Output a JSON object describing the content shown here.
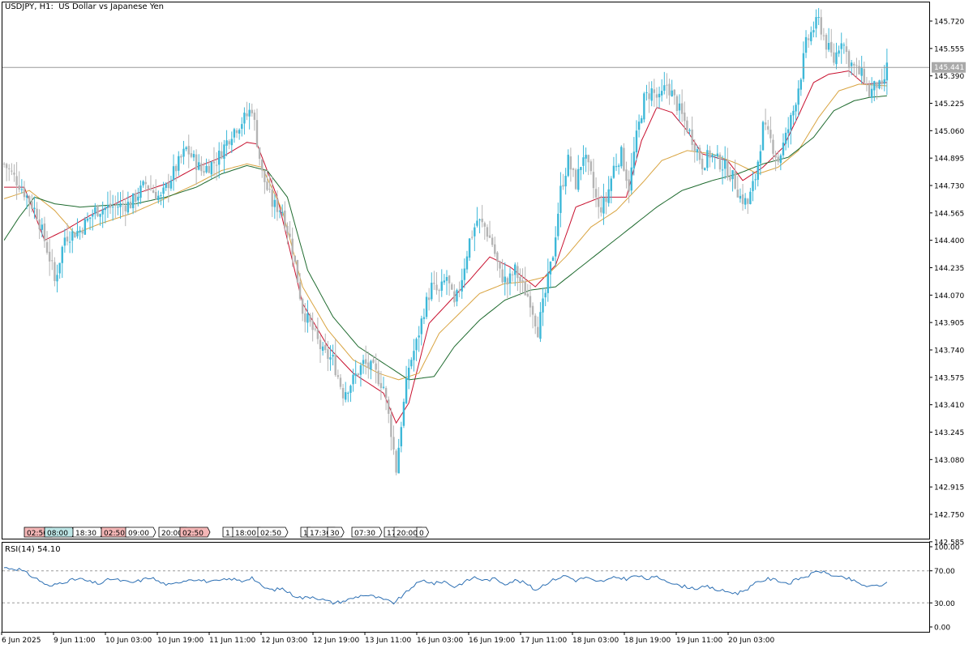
{
  "window": {
    "title": "USDJPY, H1:  US Dollar vs Japanese Yen",
    "symbol": "USDJPY",
    "timeframe": "H1",
    "description": "US Dollar vs Japanese Yen"
  },
  "colors": {
    "bull_candle": "#3db8d8",
    "bear_candle": "#b4b4b4",
    "ma_fast": "#c8102e",
    "ma_mid": "#d9a441",
    "ma_slow": "#1f6b2f",
    "rsi_line": "#2c6fb3",
    "price_line": "#9a9a9a",
    "price_label_bg": "#a9a9a9",
    "event_red": "#f4b6b6",
    "event_teal": "#bde6e6"
  },
  "price_axis": {
    "ticks": [
      "145.720",
      "145.555",
      "145.390",
      "145.225",
      "145.060",
      "144.895",
      "144.730",
      "144.565",
      "144.400",
      "144.235",
      "144.070",
      "143.905",
      "143.740",
      "143.575",
      "143.410",
      "143.245",
      "143.080",
      "142.915",
      "142.750",
      "142.585"
    ],
    "current_price_label": "145.441"
  },
  "time_axis": {
    "labels": [
      "6 Jun 2025",
      "9 Jun 11:00",
      "10 Jun 03:00",
      "10 Jun 19:00",
      "11 Jun 11:00",
      "12 Jun 03:00",
      "12 Jun 19:00",
      "13 Jun 11:00",
      "16 Jun 03:00",
      "16 Jun 19:00",
      "17 Jun 11:00",
      "18 Jun 03:00",
      "18 Jun 19:00",
      "19 Jun 11:00",
      "20 Jun 03:00"
    ]
  },
  "event_markers": [
    {
      "text": "02:50",
      "color": "red"
    },
    {
      "text": "08:00",
      "color": "teal"
    },
    {
      "text": "18:30",
      "color": "none"
    },
    {
      "text": "02:50",
      "color": "red"
    },
    {
      "text": "09:00",
      "color": "none"
    },
    {
      "text": "20:00",
      "color": "none"
    },
    {
      "text": "02:50",
      "color": "red"
    },
    {
      "text": "1",
      "color": "none"
    },
    {
      "text": "18:00",
      "color": "none"
    },
    {
      "text": "02:50",
      "color": "none"
    },
    {
      "text": "1",
      "color": "none"
    },
    {
      "text": "17:30",
      "color": "none"
    },
    {
      "text": "30",
      "color": "none"
    },
    {
      "text": "07:30",
      "color": "none"
    },
    {
      "text": "17",
      "color": "none"
    },
    {
      "text": "20:00",
      "color": "none"
    },
    {
      "text": "0",
      "color": "none"
    }
  ],
  "rsi": {
    "title": "RSI(14) 54.10",
    "ticks": [
      "100.00",
      "70.00",
      "30.00",
      "0.00"
    ],
    "levels": [
      70,
      30
    ]
  },
  "chart_data": {
    "type": "candlestick",
    "ylim": [
      142.45,
      145.8
    ],
    "current_price": 145.441,
    "xlabel": "",
    "ylabel": "",
    "candle_keypoints": [
      [
        0,
        144.86
      ],
      [
        6,
        144.74
      ],
      [
        10,
        144.64
      ],
      [
        13,
        144.56
      ],
      [
        16,
        144.4
      ],
      [
        19,
        144.24
      ],
      [
        20,
        144.15
      ],
      [
        24,
        144.42
      ],
      [
        30,
        144.46
      ],
      [
        36,
        144.58
      ],
      [
        42,
        144.6
      ],
      [
        50,
        144.62
      ],
      [
        56,
        144.74
      ],
      [
        62,
        144.65
      ],
      [
        66,
        144.78
      ],
      [
        72,
        144.95
      ],
      [
        78,
        144.82
      ],
      [
        84,
        144.88
      ],
      [
        90,
        145.05
      ],
      [
        96,
        145.15
      ],
      [
        98,
        145.2
      ],
      [
        102,
        144.8
      ],
      [
        106,
        144.62
      ],
      [
        110,
        144.58
      ],
      [
        114,
        144.35
      ],
      [
        118,
        143.98
      ],
      [
        122,
        143.86
      ],
      [
        126,
        143.72
      ],
      [
        130,
        143.68
      ],
      [
        134,
        143.48
      ],
      [
        138,
        143.56
      ],
      [
        142,
        143.66
      ],
      [
        146,
        143.62
      ],
      [
        150,
        143.52
      ],
      [
        153,
        143.25
      ],
      [
        155,
        143.02
      ],
      [
        157,
        143.3
      ],
      [
        160,
        143.64
      ],
      [
        163,
        143.78
      ],
      [
        166,
        143.98
      ],
      [
        169,
        144.12
      ],
      [
        172,
        144.08
      ],
      [
        175,
        144.18
      ],
      [
        178,
        144.0
      ],
      [
        181,
        144.18
      ],
      [
        184,
        144.4
      ],
      [
        187,
        144.52
      ],
      [
        190,
        144.48
      ],
      [
        193,
        144.38
      ],
      [
        196,
        144.2
      ],
      [
        199,
        144.14
      ],
      [
        202,
        144.22
      ],
      [
        205,
        144.12
      ],
      [
        208,
        144.04
      ],
      [
        211,
        143.86
      ],
      [
        214,
        144.08
      ],
      [
        217,
        144.32
      ],
      [
        220,
        144.7
      ],
      [
        223,
        144.88
      ],
      [
        226,
        144.74
      ],
      [
        229,
        144.92
      ],
      [
        232,
        144.78
      ],
      [
        235,
        144.58
      ],
      [
        238,
        144.64
      ],
      [
        241,
        144.84
      ],
      [
        244,
        144.92
      ],
      [
        247,
        144.72
      ],
      [
        250,
        145.02
      ],
      [
        253,
        145.25
      ],
      [
        256,
        145.3
      ],
      [
        259,
        145.24
      ],
      [
        262,
        145.34
      ],
      [
        264,
        145.28
      ],
      [
        267,
        145.18
      ],
      [
        270,
        145.08
      ],
      [
        273,
        144.98
      ],
      [
        276,
        144.86
      ],
      [
        279,
        144.92
      ],
      [
        282,
        144.88
      ],
      [
        285,
        144.84
      ],
      [
        288,
        144.78
      ],
      [
        291,
        144.66
      ],
      [
        294,
        144.62
      ],
      [
        297,
        144.78
      ],
      [
        300,
        145.08
      ],
      [
        303,
        145.0
      ],
      [
        306,
        144.88
      ],
      [
        309,
        145.02
      ],
      [
        312,
        145.18
      ],
      [
        315,
        145.4
      ],
      [
        317,
        145.58
      ],
      [
        320,
        145.68
      ],
      [
        322,
        145.72
      ],
      [
        325,
        145.58
      ],
      [
        328,
        145.48
      ],
      [
        331,
        145.62
      ],
      [
        334,
        145.48
      ],
      [
        337,
        145.42
      ],
      [
        340,
        145.38
      ],
      [
        342,
        145.28
      ],
      [
        345,
        145.34
      ],
      [
        347,
        145.3
      ],
      [
        349,
        145.44
      ]
    ],
    "series": [
      {
        "name": "",
        "values_keypoints": [
          [
            0,
            144.72
          ],
          [
            8,
            144.72
          ],
          [
            16,
            144.4
          ],
          [
            24,
            144.46
          ],
          [
            34,
            144.55
          ],
          [
            44,
            144.62
          ],
          [
            52,
            144.68
          ],
          [
            64,
            144.74
          ],
          [
            76,
            144.84
          ],
          [
            86,
            144.9
          ],
          [
            96,
            144.99
          ],
          [
            100,
            144.98
          ],
          [
            108,
            144.66
          ],
          [
            118,
            144.02
          ],
          [
            128,
            143.76
          ],
          [
            138,
            143.6
          ],
          [
            150,
            143.48
          ],
          [
            155,
            143.3
          ],
          [
            160,
            143.42
          ],
          [
            168,
            143.9
          ],
          [
            176,
            144.03
          ],
          [
            184,
            144.16
          ],
          [
            192,
            144.3
          ],
          [
            200,
            144.24
          ],
          [
            210,
            144.12
          ],
          [
            218,
            144.25
          ],
          [
            226,
            144.6
          ],
          [
            236,
            144.66
          ],
          [
            246,
            144.66
          ],
          [
            252,
            145.0
          ],
          [
            258,
            145.2
          ],
          [
            264,
            145.17
          ],
          [
            270,
            145.06
          ],
          [
            276,
            144.92
          ],
          [
            286,
            144.88
          ],
          [
            292,
            144.76
          ],
          [
            300,
            144.84
          ],
          [
            308,
            144.96
          ],
          [
            314,
            145.15
          ],
          [
            320,
            145.35
          ],
          [
            326,
            145.4
          ],
          [
            334,
            145.42
          ],
          [
            340,
            145.34
          ],
          [
            349,
            145.35
          ]
        ]
      },
      {
        "name": "",
        "values_keypoints": [
          [
            0,
            144.65
          ],
          [
            10,
            144.7
          ],
          [
            20,
            144.58
          ],
          [
            28,
            144.44
          ],
          [
            38,
            144.5
          ],
          [
            50,
            144.56
          ],
          [
            62,
            144.64
          ],
          [
            76,
            144.74
          ],
          [
            86,
            144.82
          ],
          [
            96,
            144.86
          ],
          [
            102,
            144.84
          ],
          [
            110,
            144.58
          ],
          [
            118,
            144.12
          ],
          [
            128,
            143.86
          ],
          [
            138,
            143.68
          ],
          [
            148,
            143.6
          ],
          [
            156,
            143.56
          ],
          [
            164,
            143.6
          ],
          [
            172,
            143.84
          ],
          [
            180,
            143.96
          ],
          [
            188,
            144.08
          ],
          [
            198,
            144.14
          ],
          [
            206,
            144.15
          ],
          [
            214,
            144.18
          ],
          [
            222,
            144.3
          ],
          [
            232,
            144.48
          ],
          [
            242,
            144.58
          ],
          [
            252,
            144.74
          ],
          [
            260,
            144.88
          ],
          [
            270,
            144.94
          ],
          [
            280,
            144.92
          ],
          [
            290,
            144.86
          ],
          [
            298,
            144.8
          ],
          [
            306,
            144.84
          ],
          [
            314,
            144.94
          ],
          [
            322,
            145.14
          ],
          [
            330,
            145.3
          ],
          [
            338,
            145.34
          ],
          [
            349,
            145.33
          ]
        ]
      },
      {
        "name": "",
        "values_keypoints": [
          [
            0,
            144.4
          ],
          [
            6,
            144.54
          ],
          [
            12,
            144.66
          ],
          [
            20,
            144.62
          ],
          [
            30,
            144.6
          ],
          [
            40,
            144.61
          ],
          [
            52,
            144.62
          ],
          [
            64,
            144.66
          ],
          [
            76,
            144.72
          ],
          [
            86,
            144.8
          ],
          [
            96,
            144.85
          ],
          [
            104,
            144.82
          ],
          [
            112,
            144.66
          ],
          [
            120,
            144.22
          ],
          [
            130,
            143.94
          ],
          [
            140,
            143.76
          ],
          [
            150,
            143.66
          ],
          [
            160,
            143.56
          ],
          [
            170,
            143.58
          ],
          [
            178,
            143.76
          ],
          [
            188,
            143.92
          ],
          [
            198,
            144.04
          ],
          [
            208,
            144.1
          ],
          [
            218,
            144.12
          ],
          [
            228,
            144.24
          ],
          [
            238,
            144.36
          ],
          [
            248,
            144.48
          ],
          [
            258,
            144.6
          ],
          [
            268,
            144.7
          ],
          [
            280,
            144.76
          ],
          [
            290,
            144.8
          ],
          [
            300,
            144.86
          ],
          [
            310,
            144.9
          ],
          [
            320,
            145.02
          ],
          [
            328,
            145.18
          ],
          [
            336,
            145.24
          ],
          [
            342,
            145.26
          ],
          [
            349,
            145.27
          ]
        ]
      }
    ],
    "rsi_keypoints": [
      [
        0,
        74
      ],
      [
        6,
        72
      ],
      [
        10,
        65
      ],
      [
        14,
        58
      ],
      [
        18,
        50
      ],
      [
        22,
        55
      ],
      [
        26,
        58
      ],
      [
        30,
        60
      ],
      [
        34,
        56
      ],
      [
        38,
        54
      ],
      [
        42,
        60
      ],
      [
        46,
        58
      ],
      [
        50,
        55
      ],
      [
        54,
        58
      ],
      [
        58,
        62
      ],
      [
        62,
        55
      ],
      [
        66,
        52
      ],
      [
        70,
        57
      ],
      [
        74,
        60
      ],
      [
        78,
        58
      ],
      [
        82,
        56
      ],
      [
        86,
        58
      ],
      [
        90,
        60
      ],
      [
        94,
        57
      ],
      [
        98,
        62
      ],
      [
        102,
        50
      ],
      [
        106,
        46
      ],
      [
        110,
        48
      ],
      [
        114,
        40
      ],
      [
        118,
        36
      ],
      [
        122,
        38
      ],
      [
        126,
        34
      ],
      [
        130,
        30
      ],
      [
        134,
        32
      ],
      [
        138,
        36
      ],
      [
        142,
        40
      ],
      [
        146,
        38
      ],
      [
        150,
        34
      ],
      [
        154,
        30
      ],
      [
        158,
        40
      ],
      [
        162,
        52
      ],
      [
        166,
        58
      ],
      [
        170,
        54
      ],
      [
        174,
        57
      ],
      [
        178,
        50
      ],
      [
        182,
        56
      ],
      [
        186,
        62
      ],
      [
        190,
        58
      ],
      [
        194,
        60
      ],
      [
        198,
        54
      ],
      [
        202,
        58
      ],
      [
        206,
        55
      ],
      [
        210,
        46
      ],
      [
        214,
        54
      ],
      [
        218,
        60
      ],
      [
        222,
        64
      ],
      [
        226,
        58
      ],
      [
        230,
        62
      ],
      [
        234,
        56
      ],
      [
        238,
        58
      ],
      [
        242,
        62
      ],
      [
        246,
        60
      ],
      [
        250,
        64
      ],
      [
        254,
        60
      ],
      [
        258,
        62
      ],
      [
        262,
        58
      ],
      [
        266,
        52
      ],
      [
        270,
        50
      ],
      [
        274,
        48
      ],
      [
        278,
        50
      ],
      [
        282,
        46
      ],
      [
        286,
        44
      ],
      [
        290,
        42
      ],
      [
        294,
        48
      ],
      [
        298,
        56
      ],
      [
        302,
        60
      ],
      [
        306,
        58
      ],
      [
        310,
        54
      ],
      [
        314,
        60
      ],
      [
        318,
        64
      ],
      [
        322,
        70
      ],
      [
        326,
        66
      ],
      [
        330,
        62
      ],
      [
        334,
        60
      ],
      [
        338,
        54
      ],
      [
        342,
        50
      ],
      [
        346,
        52
      ],
      [
        349,
        54.1
      ]
    ]
  }
}
